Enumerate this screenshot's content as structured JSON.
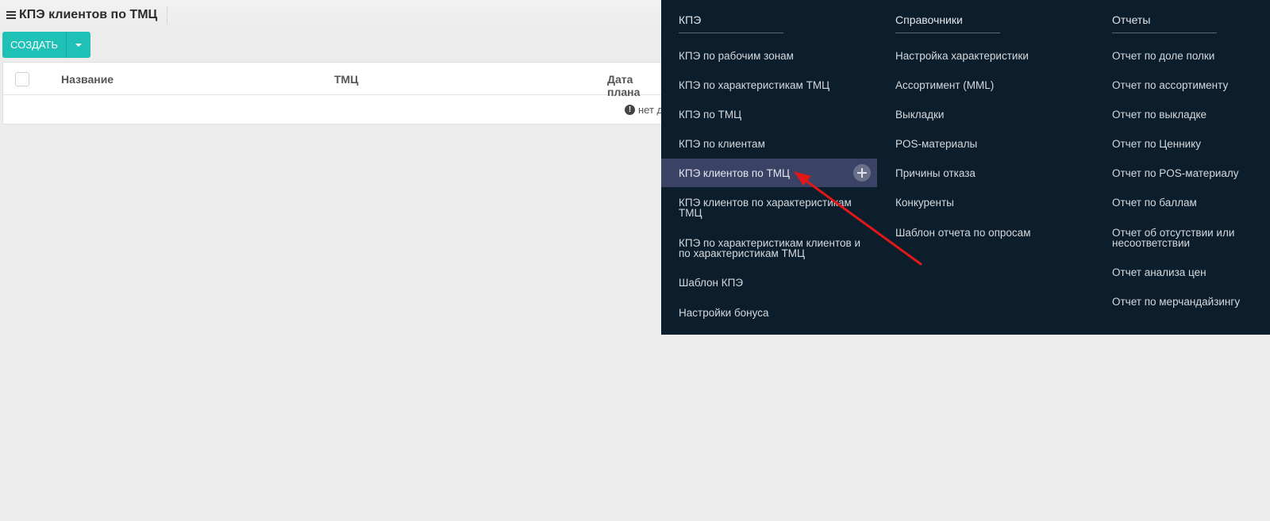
{
  "header": {
    "title": "КПЭ клиентов по ТМЦ",
    "menu_icon": "hamburger-icon"
  },
  "toolbar": {
    "create_label": "СОЗДАТЬ",
    "dropdown_icon": "caret-down-icon",
    "accent_color": "#1fc1b6"
  },
  "table": {
    "columns": [
      "Название",
      "ТМЦ",
      "Дата плана"
    ],
    "empty_message": "нет д",
    "info_icon": "exclamation-circle-icon"
  },
  "menu": {
    "background": "#0c1e2c",
    "active_background": "#3a4266",
    "kpe": {
      "title": "КПЭ",
      "items": [
        "КПЭ по рабочим зонам",
        "КПЭ по характеристикам ТМЦ",
        "КПЭ по ТМЦ",
        "КПЭ по клиентам",
        "КПЭ клиентов по ТМЦ",
        "КПЭ клиентов по характеристикам ТМЦ",
        "КПЭ по характеристикам клиентов и по характеристикам ТМЦ",
        "Шаблон КПЭ",
        "Настройки бонуса"
      ],
      "active_index": 4,
      "active_action_icon": "plus-icon"
    },
    "references": {
      "title": "Справочники",
      "items": [
        "Настройка характеристики",
        "Ассортимент (MML)",
        "Выкладки",
        "POS-материалы",
        "Причины отказа",
        "Конкуренты",
        "Шаблон отчета по опросам"
      ]
    },
    "reports": {
      "title": "Отчеты",
      "items": [
        "Отчет по доле полки",
        "Отчет по ассортименту",
        "Отчет по выкладке",
        "Отчет по Ценнику",
        "Отчет по POS-материалу",
        "Отчет по баллам",
        "Отчет об отсутствии или несоответствии",
        "Отчет анализа цен",
        "Отчет по мерчандайзингу"
      ]
    }
  },
  "annotation": {
    "arrow_color": "#e01818",
    "arrow_icon": "red-arrow-annotation"
  }
}
